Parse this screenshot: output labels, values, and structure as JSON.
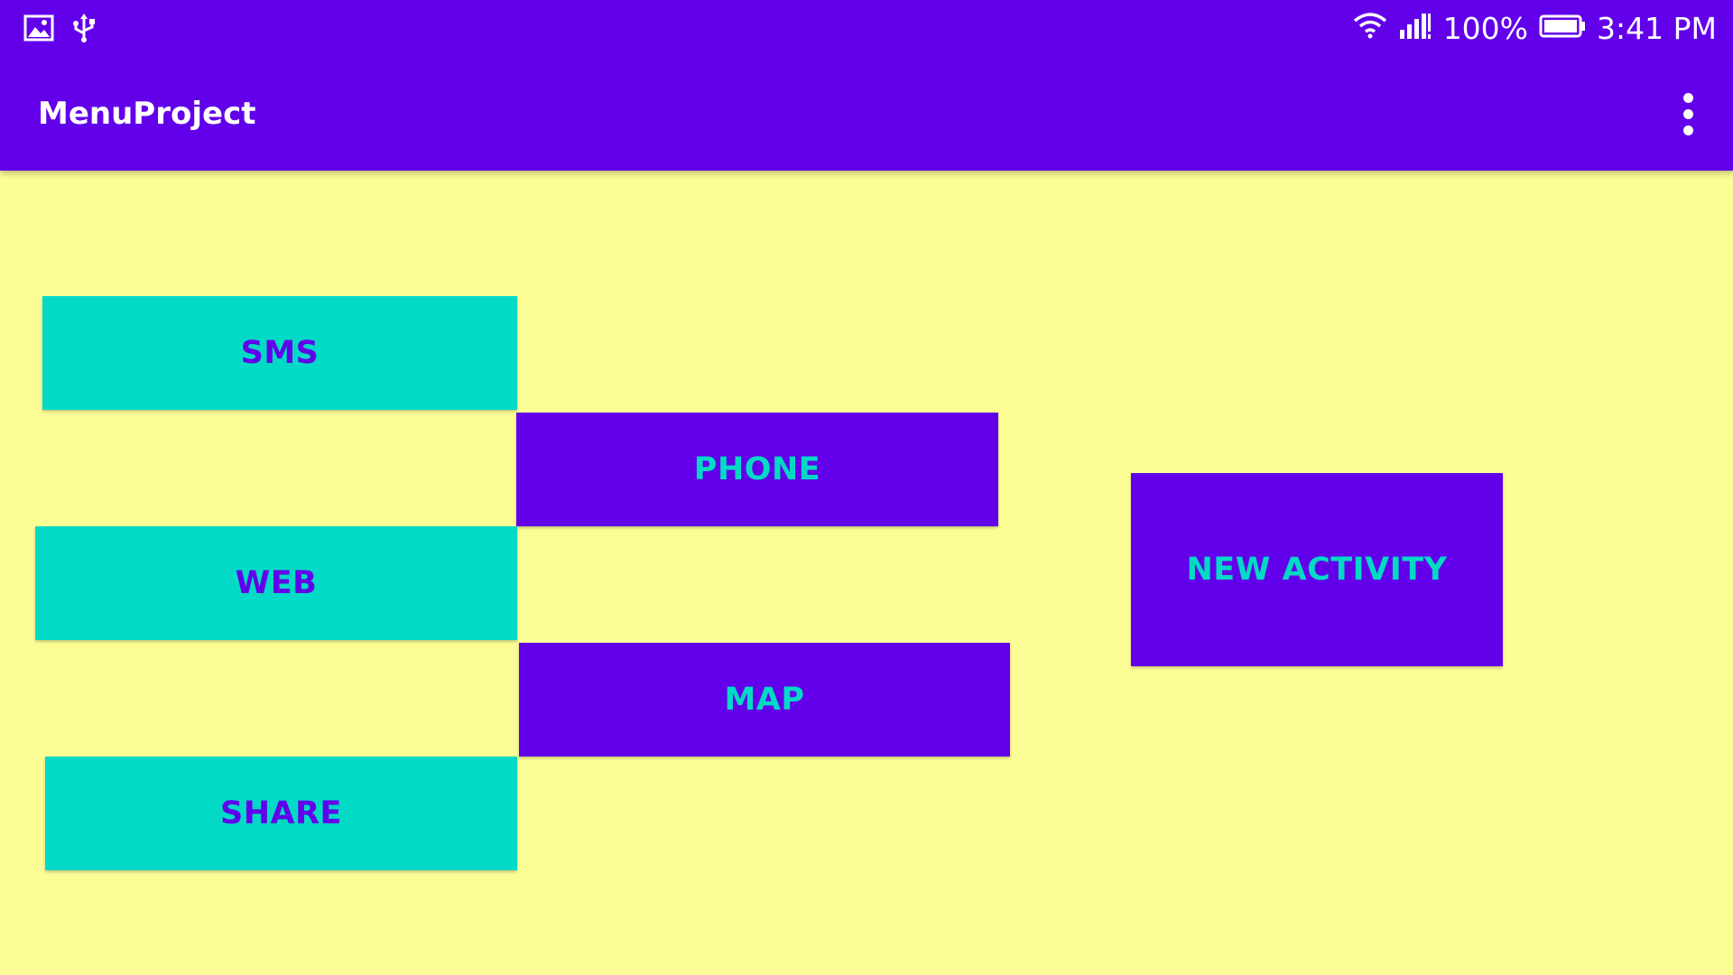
{
  "status_bar": {
    "left_icons": [
      "image-icon",
      "usb-icon"
    ],
    "right_icons": [
      "wifi-icon",
      "signal-icon",
      "battery-icon"
    ],
    "battery_text": "100%",
    "time": "3:41 PM",
    "background_color": "#6200ea"
  },
  "app_bar": {
    "title": "MenuProject",
    "overflow_icon": "more-vert-icon",
    "background_color": "#6200ea"
  },
  "content": {
    "background_color": "#fdfd96",
    "buttons": {
      "sms": "SMS",
      "phone": "PHONE",
      "web": "WEB",
      "map": "MAP",
      "share": "SHARE",
      "new_activity": "NEW ACTIVITY"
    },
    "colors": {
      "teal": "#03dac5",
      "purple": "#6200ea"
    }
  }
}
